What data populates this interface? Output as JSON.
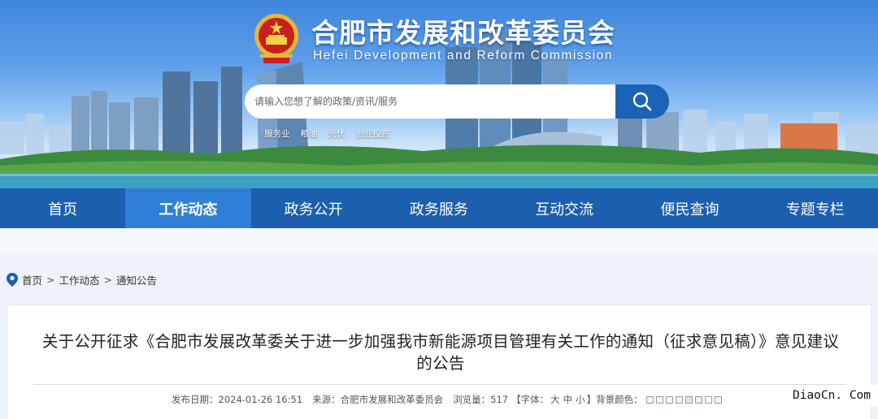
{
  "header": {
    "title": "合肥市发展和改革委员会",
    "subtitle": "Hefei Development and Reform Commission"
  },
  "search": {
    "placeholder": "请输入您想了解的政策/资讯/服务",
    "hot_words": [
      "服务业",
      "粮油",
      "光伏",
      "创业投资"
    ]
  },
  "nav": {
    "items": [
      "首页",
      "工作动态",
      "政务公开",
      "政务服务",
      "互动交流",
      "便民查询",
      "专题专栏"
    ],
    "active_index": 1
  },
  "breadcrumb": [
    "首页",
    "工作动态",
    "通知公告"
  ],
  "breadcrumb_sep": ">",
  "article": {
    "title": "关于公开征求《合肥市发展改革委关于进一步加强我市新能源项目管理有关工作的通知（征求意见稿）》意见建议的公告",
    "publish_label": "发布日期：",
    "publish_date": "2024-01-26 16:51",
    "source_label": "来源：",
    "source": "合肥市发展和改革委员会",
    "views_label": "浏览量：",
    "views": "517",
    "font_label": "【字体：",
    "font_sizes": [
      "大",
      "中",
      "小"
    ],
    "font_close": "】",
    "bg_label": "背景颜色：",
    "bg_colors": [
      "#eef6fb",
      "#eefbf2",
      "#fdfbe6",
      "#f7eef8",
      "#dbe8f8",
      "#eeeeee",
      "#ffffff",
      "#f5f5f5"
    ]
  },
  "watermark": "DiaoCn. Com",
  "colors": {
    "nav_bg": "#1c5fae",
    "nav_active": "#2f7fd6",
    "search_button": "#1b63b7"
  }
}
